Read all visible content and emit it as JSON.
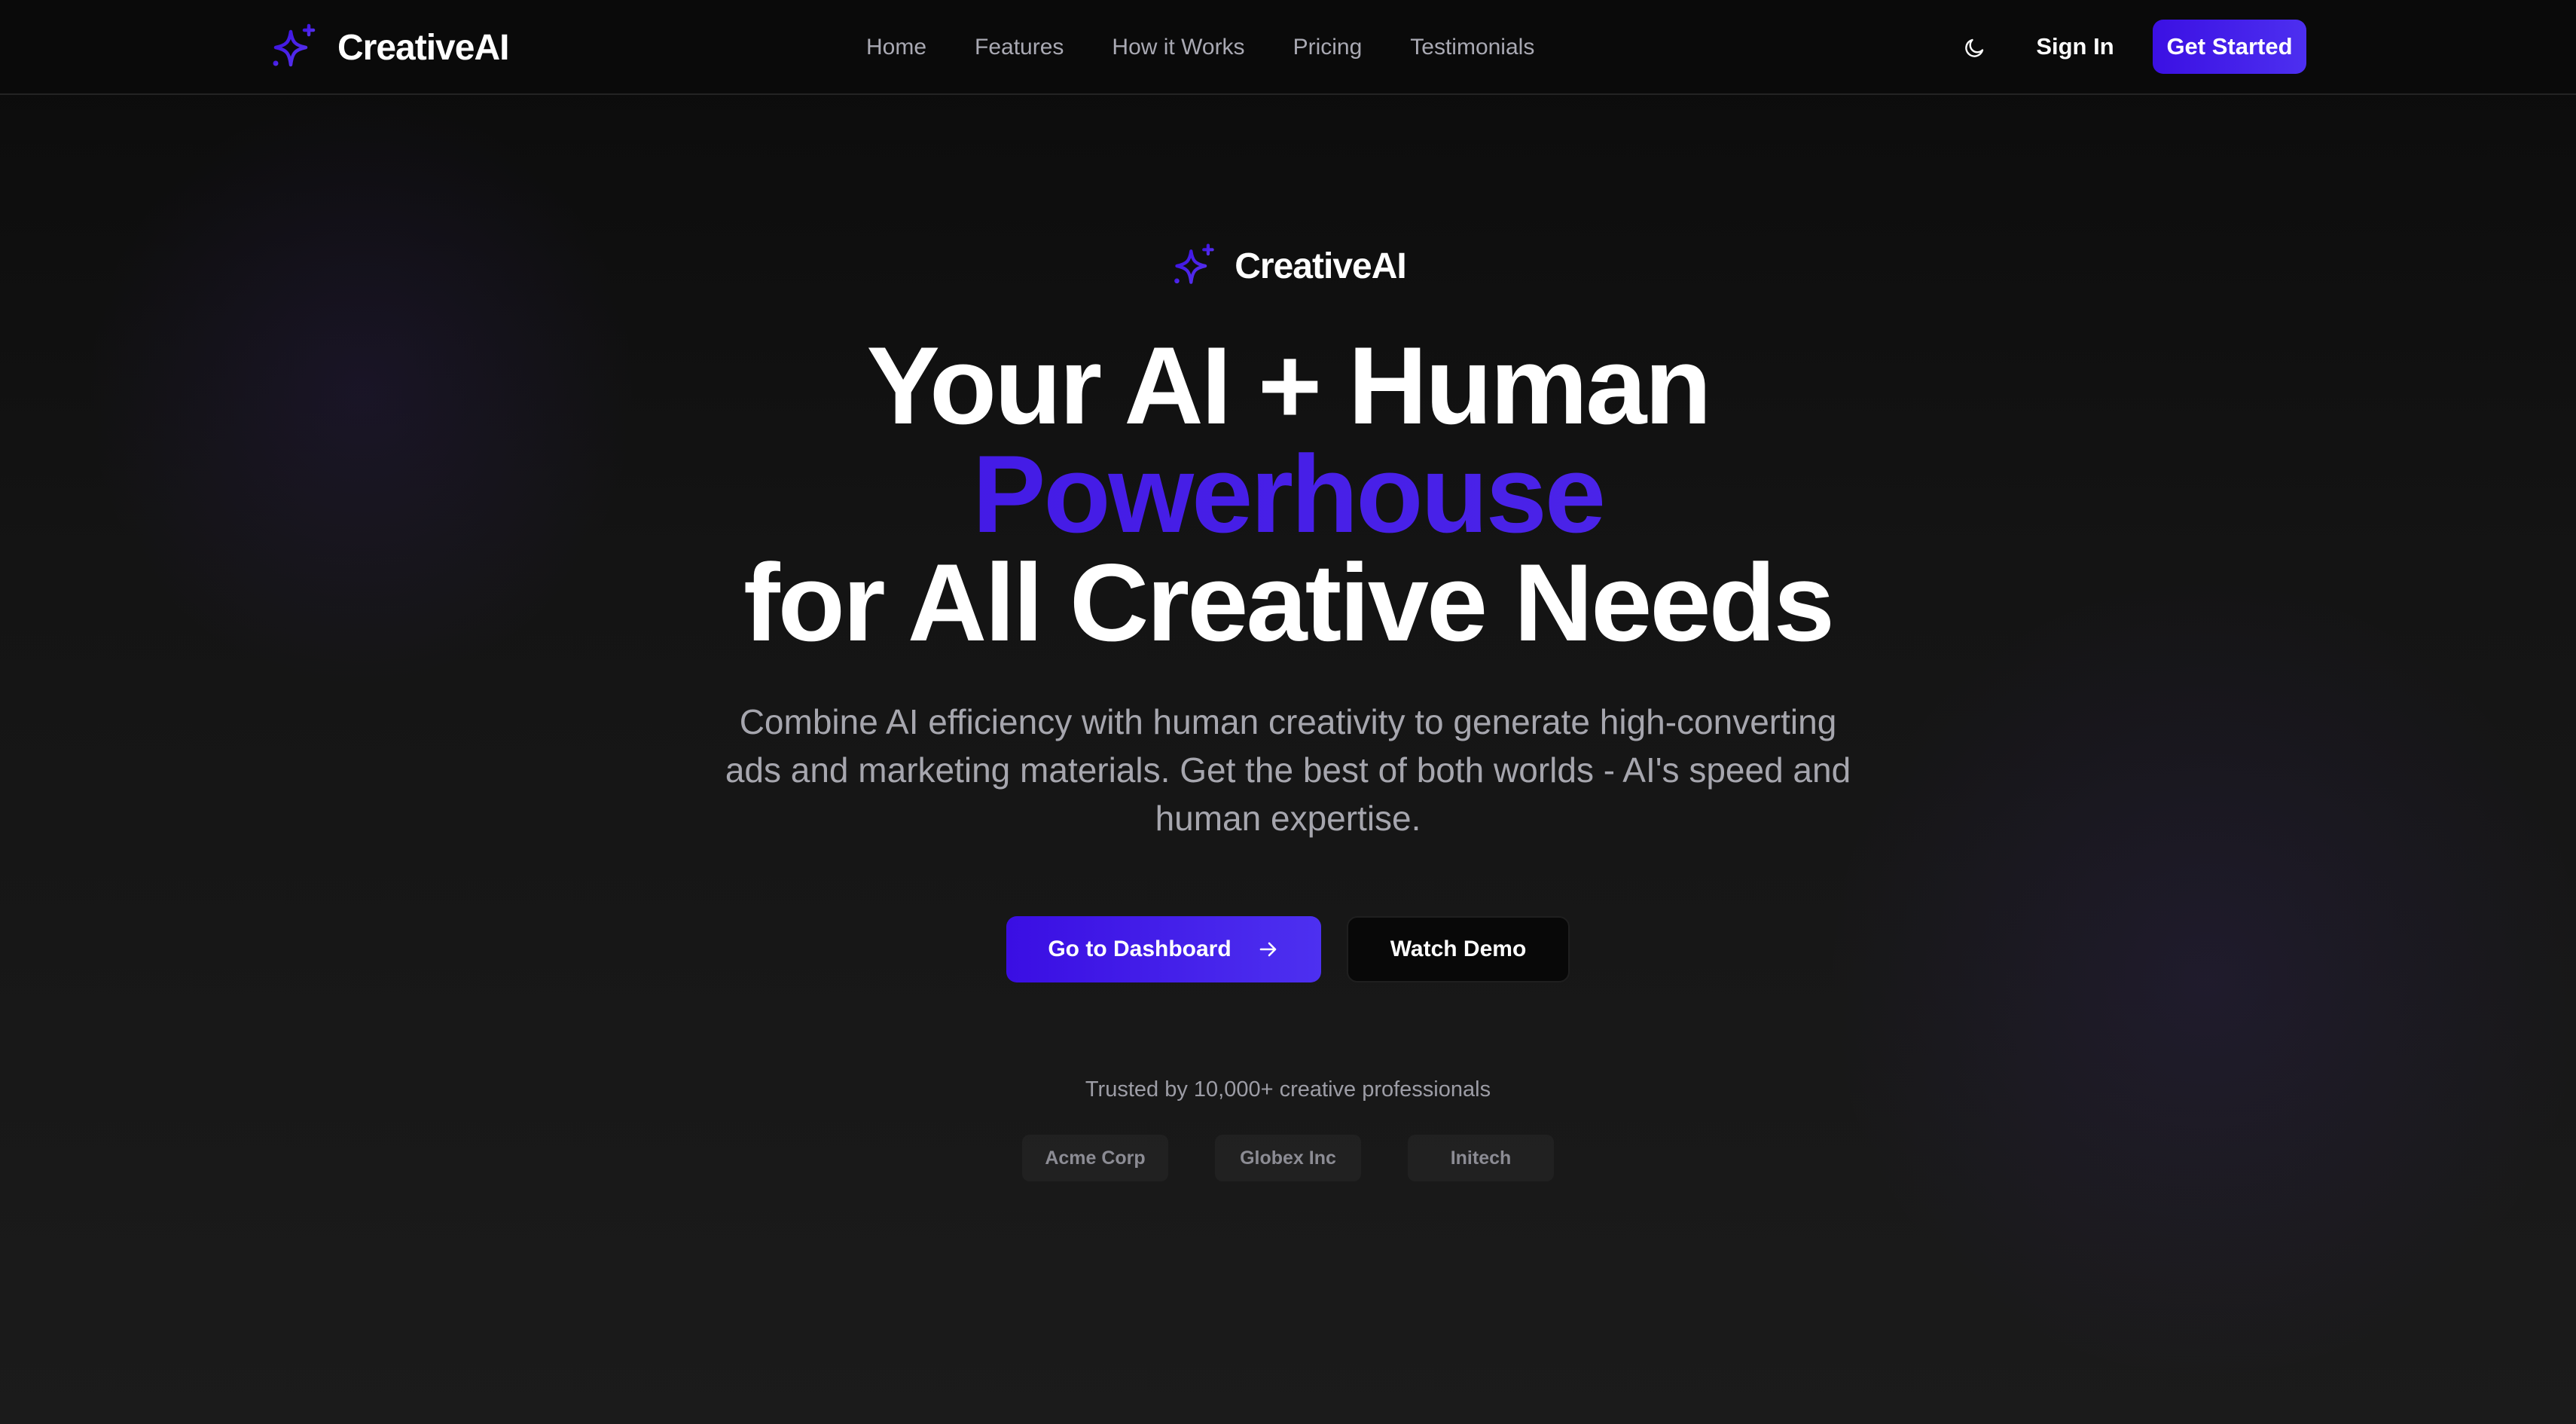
{
  "colors": {
    "accent": "#4316e6",
    "accent_light": "#5430ee",
    "background": "#121212",
    "muted_text": "#a6a6ae"
  },
  "navbar": {
    "brand": {
      "icon": "sparkles-icon",
      "name": "CreativeAI"
    },
    "links": [
      "Home",
      "Features",
      "How it Works",
      "Pricing",
      "Testimonials"
    ],
    "theme_toggle_icon": "moon-icon",
    "sign_in_label": "Sign In",
    "get_started_label": "Get Started"
  },
  "hero": {
    "brand": {
      "icon": "sparkles-icon",
      "name": "CreativeAI"
    },
    "headline": {
      "line1": "Your AI + Human",
      "accent": "Powerhouse",
      "line3": "for All Creative Needs"
    },
    "subtitle": "Combine AI efficiency with human creativity to generate high-converting ads and marketing materials. Get the best of both worlds - AI's speed and human expertise.",
    "primary_cta": {
      "label": "Go to Dashboard",
      "icon": "arrow-right-icon"
    },
    "secondary_cta": {
      "label": "Watch Demo"
    },
    "trusted_text": "Trusted by 10,000+ creative professionals",
    "trusted_logos": [
      "Acme Corp",
      "Globex Inc",
      "Initech"
    ]
  }
}
